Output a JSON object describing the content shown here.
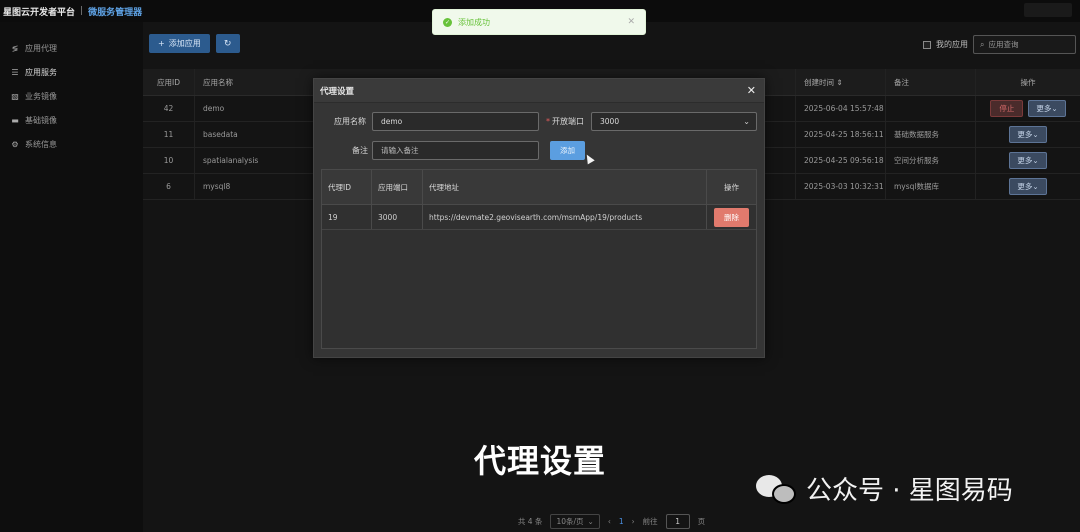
{
  "header": {
    "brand": "星图云开发者平台",
    "separator": "|",
    "subtitle": "微服务管理器"
  },
  "sidebar": {
    "items": [
      {
        "label": "应用代理",
        "icon": "share-icon"
      },
      {
        "label": "应用服务",
        "icon": "sliders-icon"
      },
      {
        "label": "业务镜像",
        "icon": "image-icon"
      },
      {
        "label": "基础镜像",
        "icon": "monitor-icon"
      },
      {
        "label": "系统信息",
        "icon": "gear-icon"
      }
    ]
  },
  "toolbar": {
    "add_label": "添加应用",
    "refresh_icon": "refresh-icon",
    "mine_label": "我的应用",
    "search_placeholder": "应用查询"
  },
  "table": {
    "headers": {
      "id": "应用ID",
      "name": "应用名称",
      "time": "创建时间 ⇕",
      "note": "备注",
      "op": "操作"
    },
    "rows": [
      {
        "id": "42",
        "name": "demo",
        "time": "2025-06-04 15:57:48",
        "note": "",
        "stop": "停止",
        "more": "更多⌄"
      },
      {
        "id": "11",
        "name": "basedata",
        "time": "2025-04-25 18:56:11",
        "note": "基础数据服务",
        "more": "更多⌄"
      },
      {
        "id": "10",
        "name": "spatialanalysis",
        "time": "2025-04-25 09:56:18",
        "note": "空间分析服务",
        "more": "更多⌄"
      },
      {
        "id": "6",
        "name": "mysql8",
        "time": "2025-03-03 10:32:31",
        "note": "mysql数据库",
        "more": "更多⌄"
      }
    ]
  },
  "pager": {
    "total": "共 4 条",
    "page_size": "10条/页",
    "prev": "‹",
    "current": "1",
    "next": "›",
    "goto_label": "前往",
    "goto_value": "1",
    "page_unit": "页"
  },
  "toast": {
    "message": "添加成功"
  },
  "dialog": {
    "title": "代理设置",
    "name_label": "应用名称",
    "name_value": "demo",
    "port_label": "开放端口",
    "port_value": "3000",
    "note_label": "备注",
    "note_placeholder": "请输入备注",
    "add_label": "添加",
    "table": {
      "headers": {
        "id": "代理ID",
        "port": "应用端口",
        "url": "代理地址",
        "op": "操作"
      },
      "rows": [
        {
          "id": "19",
          "port": "3000",
          "url": "https://devmate2.geovisearth.com/msmApp/19/products",
          "delete": "删除"
        }
      ]
    }
  },
  "overlay": {
    "caption": "代理设置",
    "watermark": "公众号 · 星图易码"
  }
}
